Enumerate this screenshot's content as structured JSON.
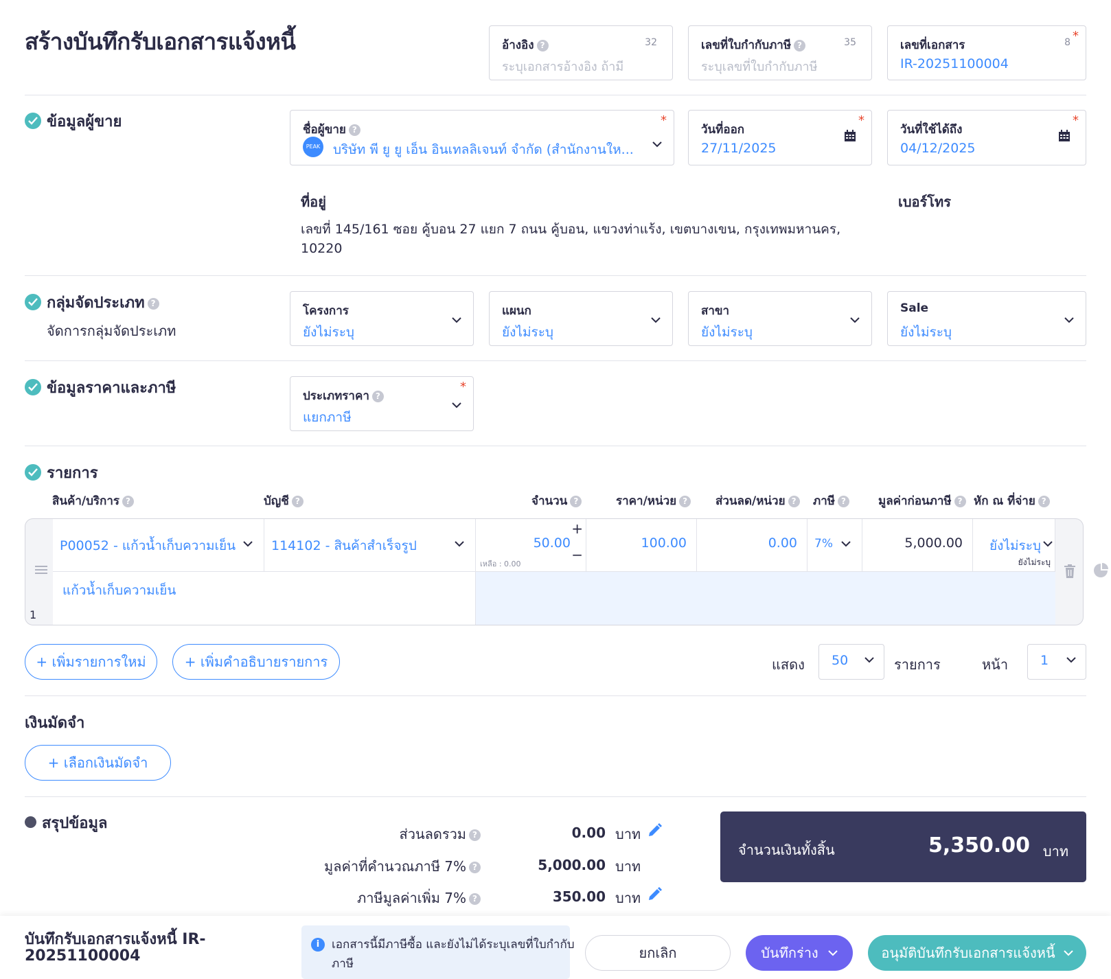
{
  "page_title": "สร้างบันทึกรับเอกสารแจ้งหนี้",
  "header_fields": {
    "reference": {
      "label": "อ้างอิง",
      "counter": "32",
      "placeholder": "ระบุเอกสารอ้างอิง ถ้ามี"
    },
    "tax_invoice_no": {
      "label": "เลขที่ใบกำกับภาษี",
      "counter": "35",
      "placeholder": "ระบุเลขที่ใบกำกับภาษี"
    },
    "doc_no": {
      "label": "เลขที่เอกสาร",
      "counter": "8",
      "value": "IR-20251100004"
    }
  },
  "seller": {
    "section_title": "ข้อมูลผู้ขาย",
    "name_label": "ชื่อผู้ขาย",
    "avatar_text": "PEAK",
    "name_value": "บริษัท พี ยู ยู เอ็น อินเทลลิเจนท์ จำกัด (สำนักงานให...",
    "issue_date_label": "วันที่ออก",
    "issue_date": "27/11/2025",
    "due_date_label": "วันที่ใช้ได้ถึง",
    "due_date": "04/12/2025",
    "address_label": "ที่อยู่",
    "address_line1": "เลขที่ 145/161 ซอย คู้บอน 27 แยก 7 ถนน คู้บอน, แขวงท่าแร้ง, เขตบางเขน, กรุงเทพมหานคร,",
    "address_line2": "10220",
    "phone_label": "เบอร์โทร"
  },
  "category": {
    "section_title": "กลุ่มจัดประเภท",
    "manage_link": "จัดการกลุ่มจัดประเภท",
    "fields": [
      {
        "label": "โครงการ",
        "value": "ยังไม่ระบุ"
      },
      {
        "label": "แผนก",
        "value": "ยังไม่ระบุ"
      },
      {
        "label": "สาขา",
        "value": "ยังไม่ระบุ"
      },
      {
        "label": "Sale",
        "value": "ยังไม่ระบุ"
      }
    ]
  },
  "pricing": {
    "section_title": "ข้อมูลราคาและภาษี",
    "price_type_label": "ประเภทราคา",
    "price_type_value": "แยกภาษี"
  },
  "items": {
    "section_title": "รายการ",
    "columns": [
      "สินค้า/บริการ",
      "บัญชี",
      "จำนวน",
      "ราคา/หน่วย",
      "ส่วนลด/หน่วย",
      "ภาษี",
      "มูลค่าก่อนภาษี",
      "หัก ณ ที่จ่าย"
    ],
    "row": {
      "index": "1",
      "product": "P00052 - แก้วน้ำเก็บความเย็น",
      "account": "114102 - สินค้าสำเร็จรูป",
      "qty": "50.00",
      "remaining": "เหลือ : 0.00",
      "unit_price": "100.00",
      "discount": "0.00",
      "tax": "7%",
      "pre_tax": "5,000.00",
      "wht": "ยังไม่ระบุ",
      "wht_sub": "ยังไม่ระบุ",
      "description": "แก้วน้ำเก็บความเย็น"
    },
    "add_item_btn": "+ เพิ่มรายการใหม่",
    "add_desc_btn": "+ เพิ่มคำอธิบายรายการ",
    "show_label": "แสดง",
    "page_size": "50",
    "items_label": "รายการ",
    "page_label": "หน้า",
    "page_no": "1"
  },
  "deposit": {
    "title": "เงินมัดจำ",
    "select_btn": "+ เลือกเงินมัดจำ"
  },
  "summary": {
    "title": "สรุปข้อมูล",
    "rows": [
      {
        "label": "ส่วนลดรวม",
        "value": "0.00",
        "unit": "บาท"
      },
      {
        "label": "มูลค่าที่คำนวณภาษี 7%",
        "value": "5,000.00",
        "unit": "บาท"
      },
      {
        "label": "ภาษีมูลค่าเพิ่ม 7%",
        "value": "350.00",
        "unit": "บาท"
      }
    ],
    "total_label": "จำนวนเงินทั้งสิ้น",
    "total_value": "5,350.00",
    "total_unit": "บาท"
  },
  "footer": {
    "doc_title_line1": "บันทึกรับเอกสารแจ้งหนี้ IR-",
    "doc_title_line2": "20251100004",
    "notice_line1": "เอกสารนี้มีภาษีซื้อ และยังไม่ได้ระบุเลขที่ใบกำกับ",
    "notice_line2": "ภาษี",
    "cancel_btn": "ยกเลิก",
    "draft_btn": "บันทึกร่าง",
    "approve_btn": "อนุมัติบันทึกรับเอกสารแจ้งหนี้"
  },
  "colors": {
    "accent": "#3d8bff",
    "teal": "#4dbcbe",
    "purple": "#6c63f0",
    "dark_panel": "#393a5e"
  }
}
